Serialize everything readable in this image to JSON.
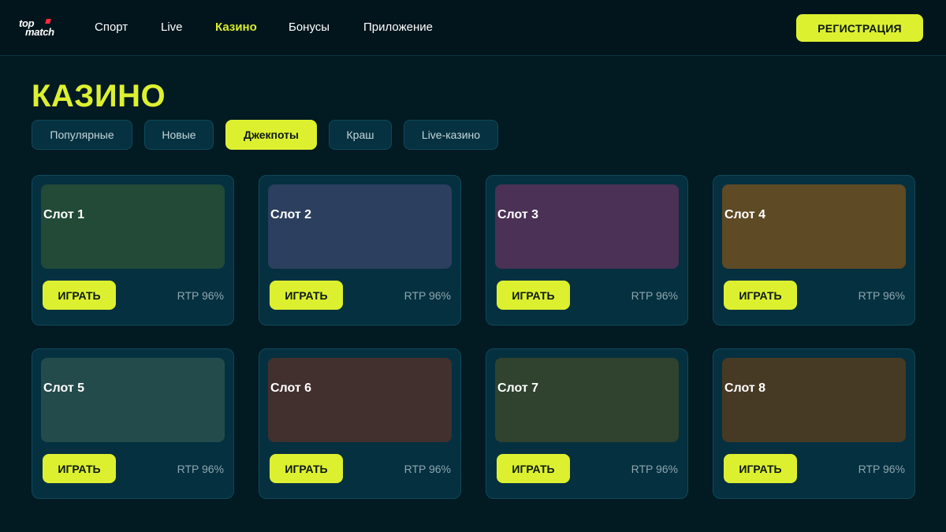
{
  "header": {
    "logo_top": "top",
    "logo_bottom": "match",
    "nav": [
      {
        "label": "Спорт",
        "active": false
      },
      {
        "label": "Live",
        "active": false
      },
      {
        "label": "Казино",
        "active": true
      },
      {
        "label": "Бонусы",
        "active": false
      },
      {
        "label": "Приложение",
        "active": false
      }
    ],
    "register_label": "РЕГИСТРАЦИЯ"
  },
  "main": {
    "title": "КАЗИНО",
    "filters": [
      {
        "label": "Популярные",
        "active": false
      },
      {
        "label": "Новые",
        "active": false
      },
      {
        "label": "Джекпоты",
        "active": true
      },
      {
        "label": "Краш",
        "active": false
      },
      {
        "label": "Live-казино",
        "active": false
      }
    ],
    "slots": [
      {
        "name": "Слот 1",
        "play_label": "ИГРАТЬ",
        "rtp": "RTP 96%",
        "thumb_color": "#224a37"
      },
      {
        "name": "Слот 2",
        "play_label": "ИГРАТЬ",
        "rtp": "RTP 96%",
        "thumb_color": "#2c3f5e"
      },
      {
        "name": "Слот 3",
        "play_label": "ИГРАТЬ",
        "rtp": "RTP 96%",
        "thumb_color": "#4a3155"
      },
      {
        "name": "Слот 4",
        "play_label": "ИГРАТЬ",
        "rtp": "RTP 96%",
        "thumb_color": "#5e4a24"
      },
      {
        "name": "Слот 5",
        "play_label": "ИГРАТЬ",
        "rtp": "RTP 96%",
        "thumb_color": "#244b4b"
      },
      {
        "name": "Слот 6",
        "play_label": "ИГРАТЬ",
        "rtp": "RTP 96%",
        "thumb_color": "#42302e"
      },
      {
        "name": "Слот 7",
        "play_label": "ИГРАТЬ",
        "rtp": "RTP 96%",
        "thumb_color": "#2f432e"
      },
      {
        "name": "Слот 8",
        "play_label": "ИГРАТЬ",
        "rtp": "RTP 96%",
        "thumb_color": "#473a25"
      }
    ]
  },
  "colors": {
    "accent": "#ddf030",
    "background": "#021a22",
    "card": "#053040"
  }
}
